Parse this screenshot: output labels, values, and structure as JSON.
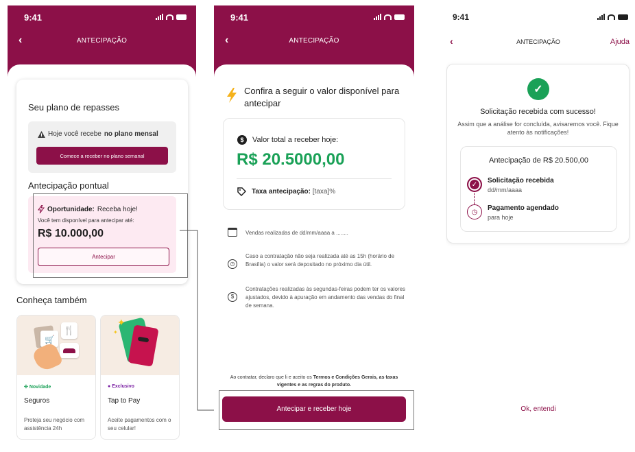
{
  "colors": {
    "brand": "#8c1048",
    "success": "#1aa157",
    "highlight": "#fdeaf2"
  },
  "status_bar": {
    "time": "9:41"
  },
  "screen1": {
    "title": "ANTECIPAÇÃO",
    "plan_heading": "Seu plano de repasses",
    "plan_text": "Hoje você recebe",
    "plan_text_bold": "no plano mensal",
    "plan_button": "Comece a receber no plano semanal",
    "spot_heading": "Antecipação pontual",
    "opportunity_label": "Oportunidade:",
    "opportunity_text": "Receba hoje!",
    "available_text": "Você tem disponível para antecipar até:",
    "available_amount": "R$ 10.000,00",
    "anticipate_button": "Antecipar",
    "discover_heading": "Conheça também",
    "products": [
      {
        "tag": "Novidade",
        "name": "Seguros",
        "desc": "Proteja seu negócio com assistência 24h",
        "icon": "cart-cutlery-car-illustration",
        "tag_color": "#1aa157"
      },
      {
        "tag": "Exclusivo",
        "name": "Tap to Pay",
        "desc": "Aceite pagamentos com o seu celular!",
        "icon": "phone-card-illustration",
        "tag_color": "#7a1fa2"
      }
    ]
  },
  "screen2": {
    "title": "ANTECIPAÇÃO",
    "heading": "Confira a seguir o valor disponível para antecipar",
    "total_label": "Valor total a receber hoje:",
    "total_amount": "R$ 20.5000,00",
    "fee_label": "Taxa antecipação:",
    "fee_value": "[taxa]%",
    "info": [
      {
        "icon": "calendar-icon",
        "text": "Vendas realizadas de dd/mm/aaaa a ........"
      },
      {
        "icon": "clock-icon",
        "text": "Caso a contratação não seja realizada até as 15h (horário de Brasília) o valor será depositado no próximo dia útil."
      },
      {
        "icon": "money-icon",
        "text": "Contratações realizadas às segundas-feiras podem ter os valores ajustados, devido à apuração em andamento das vendas do final de semana."
      }
    ],
    "legal_prefix": "Ao contratar, declaro que li e aceito os",
    "legal_terms": "Termos e Condições Gerais, as taxas vigentes e as regras do produto.",
    "cta": "Antecipar e receber hoje"
  },
  "screen3": {
    "title": "ANTECIPAÇÃO",
    "help": "Ajuda",
    "success_title": "Solicitação recebida com sucesso!",
    "success_text": "Assim que a análise for concluída, avisaremos você. Fique atento às notificações!",
    "summary_title": "Antecipação de R$ 20.500,00",
    "steps": [
      {
        "title": "Solicitação recebida",
        "sub": "dd/mm/aaaa"
      },
      {
        "title": "Pagamento agendado",
        "sub": "para hoje"
      }
    ],
    "ok_button": "Ok, entendi"
  }
}
